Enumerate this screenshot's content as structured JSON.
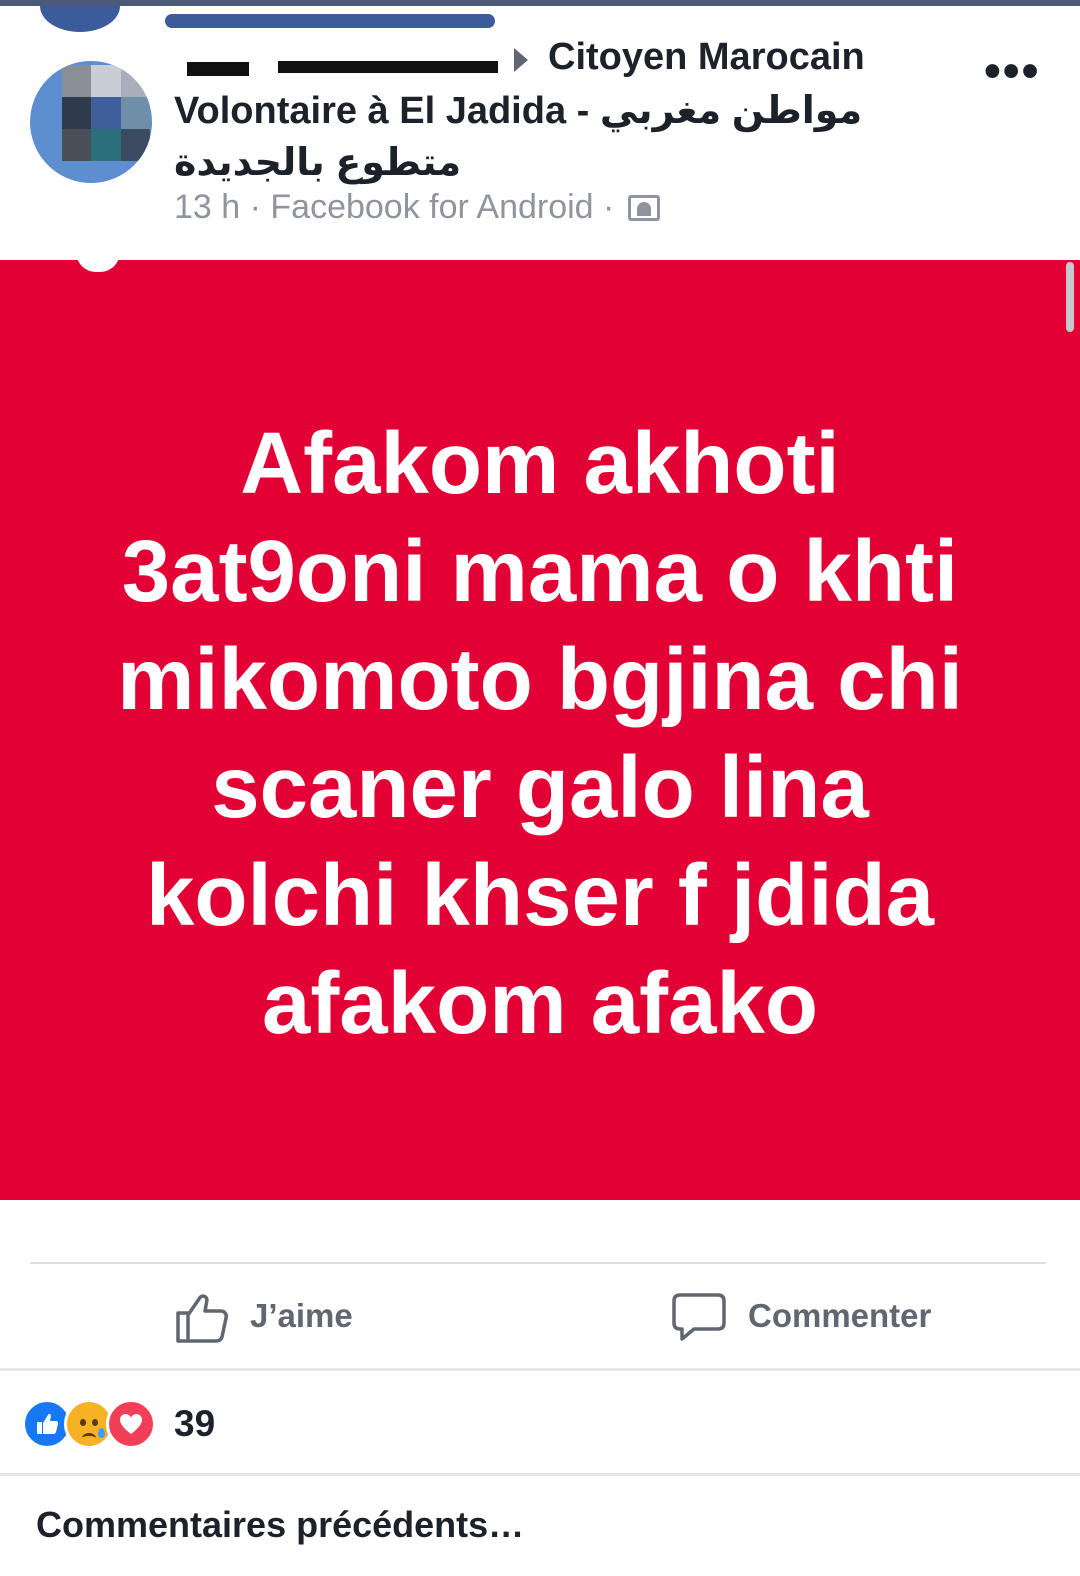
{
  "post": {
    "group_name": "Citoyen Marocain",
    "group_line2": "Volontaire à El Jadida - مواطن مغربي",
    "group_line3": "متطوع بالجديدة",
    "meta": "13 h · Facebook for Android ·",
    "audience_icon": "group-audience-icon",
    "more_icon": "more-horizontal-icon",
    "more_label": "•••"
  },
  "banner": {
    "background": "#e20035",
    "lines": [
      "Afakom akhoti",
      "3at9oni mama o khti",
      "mikomoto bgjina chi",
      "scaner galo lina",
      "kolchi khser f jdida",
      "afakom afako"
    ]
  },
  "actions": {
    "like_label": "J’aime",
    "like_icon": "thumbs-up-icon",
    "comment_label": "Commenter",
    "comment_icon": "comment-bubble-icon"
  },
  "reactions": {
    "icons": [
      "like-reaction-icon",
      "sad-reaction-icon",
      "love-reaction-icon"
    ],
    "count": "39"
  },
  "comments": {
    "previous_label": "Commentaires précédents…"
  }
}
